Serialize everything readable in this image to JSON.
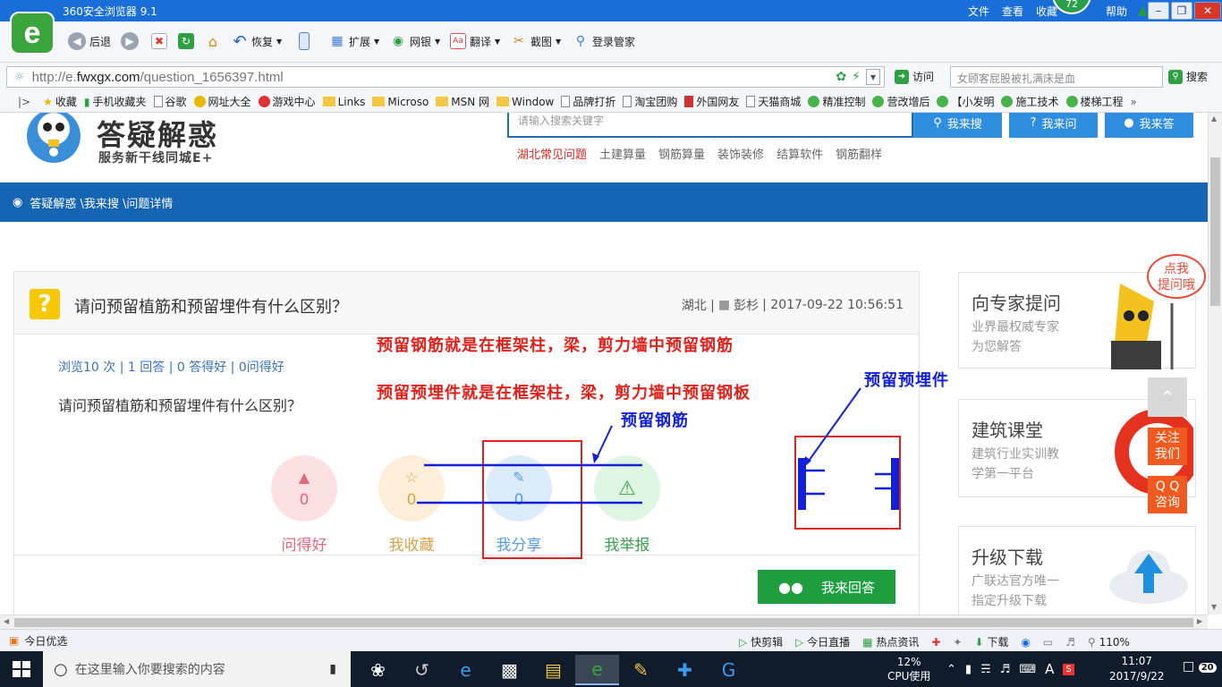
{
  "window": {
    "title": "360安全浏览器 9.1",
    "menu": [
      "文件",
      "查看",
      "收藏",
      "帮助"
    ],
    "badge": "72"
  },
  "toolbar": {
    "back": "后退",
    "restore": "恢复",
    "extend": "扩展",
    "bank": "网银",
    "translate": "翻译",
    "screenshot": "截图",
    "login": "登录管家"
  },
  "address": {
    "url_prefix": "http://e.",
    "url_domain": "fwxgx.com",
    "url_path": "/question_1656397.html",
    "go": "访问",
    "search_placeholder": "女顾客屁股被扎满床是血",
    "search_btn": "搜索"
  },
  "bookmarks": [
    {
      "label": "收藏",
      "icon": "star"
    },
    {
      "label": "手机收藏夹",
      "icon": "phone"
    },
    {
      "label": "谷歌",
      "icon": "doc"
    },
    {
      "label": "网址大全",
      "icon": "globe"
    },
    {
      "label": "游戏中心",
      "icon": "game"
    },
    {
      "label": "Links",
      "icon": "folder"
    },
    {
      "label": "Microso",
      "icon": "folder"
    },
    {
      "label": "MSN 网",
      "icon": "folder"
    },
    {
      "label": "Window",
      "icon": "folder"
    },
    {
      "label": "品牌打折",
      "icon": "doc"
    },
    {
      "label": "淘宝团购",
      "icon": "doc"
    },
    {
      "label": "外国网友",
      "icon": "flag"
    },
    {
      "label": "天猫商城",
      "icon": "doc"
    },
    {
      "label": "精准控制",
      "icon": "wechat"
    },
    {
      "label": "营改增后",
      "icon": "wechat"
    },
    {
      "label": "【小发明",
      "icon": "wechat"
    },
    {
      "label": "施工技术",
      "icon": "wechat"
    },
    {
      "label": "楼梯工程",
      "icon": "wechat"
    }
  ],
  "site": {
    "name": "答疑解惑",
    "slogan": "服务新干线同城E+",
    "search_placeholder": "请输入搜索关键字",
    "btn_search": "我来搜",
    "btn_ask": "我来问",
    "btn_answer": "我来答",
    "hotlinks": [
      "湖北常见问题",
      "土建算量",
      "钢筋算量",
      "装饰装修",
      "结算软件",
      "钢筋翻样"
    ],
    "breadcrumb": "答疑解惑 \\我来搜 \\问题详情"
  },
  "question": {
    "title": "请问预留植筋和预留埋件有什么区别？",
    "region": "湖北 |",
    "author": "彭杉",
    "date": "| 2017-09-22 10:56:51",
    "stats": "浏览10 次 | 1 回答 | 0 答得好 | 0问得好",
    "body": "请问预留植筋和预留埋件有什么区别？",
    "actions": [
      {
        "label": "问得好",
        "count": "0"
      },
      {
        "label": "我收藏",
        "count": "0"
      },
      {
        "label": "我分享",
        "count": "0"
      },
      {
        "label": "我举报",
        "count": ""
      }
    ],
    "answer_btn": "我来回答"
  },
  "sidebar": {
    "expert_title": "向专家提问",
    "expert_sub1": "业界最权威专家",
    "expert_sub2": "为您解答",
    "bubble1": "点我",
    "bubble2": "提问哦",
    "class_title": "建筑课堂",
    "class_sub1": "建筑行业实训教",
    "class_sub2": "学第一平台",
    "dl_title": "升级下载",
    "dl_sub1": "广联达官方唯一",
    "dl_sub2": "指定升级下载",
    "follow1": "关注",
    "follow2": "我们",
    "qq1": "Q Q",
    "qq2": "咨询"
  },
  "annotations": {
    "line1": "预留钢筋就是在框架柱，梁，剪力墙中预留钢筋",
    "line2": "预留预埋件就是在框架柱，梁，剪力墙中预留钢板",
    "rebar": "预留钢筋",
    "embed": "预留预埋件"
  },
  "statusbar": {
    "left": "今日优选",
    "items": [
      "快剪辑",
      "今日直播",
      "热点资讯"
    ],
    "download": "下载",
    "zoom": "110%"
  },
  "taskbar": {
    "search_placeholder": "在这里输入你要搜索的内容",
    "cpu_pct": "12%",
    "cpu_label": "CPU使用",
    "time": "11:07",
    "date": "2017/9/22",
    "notif": "20",
    "ime": "A"
  }
}
